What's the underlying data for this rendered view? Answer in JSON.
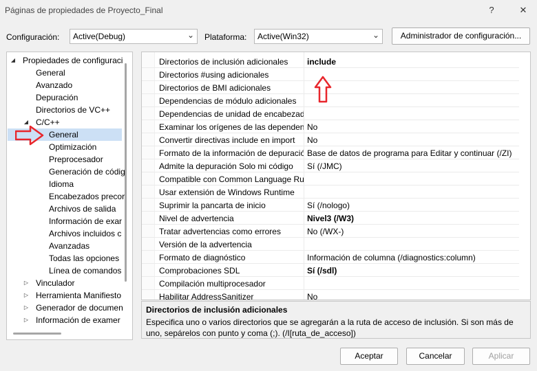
{
  "window": {
    "title": "Páginas de propiedades de Proyecto_Final",
    "help_glyph": "?",
    "close_glyph": "✕"
  },
  "toolbar": {
    "config_label": "Configuración:",
    "config_value": "Active(Debug)",
    "platform_label": "Plataforma:",
    "platform_value": "Active(Win32)",
    "config_manager_label": "Administrador de configuración..."
  },
  "tree": {
    "items": [
      {
        "label": "Propiedades de configuraci",
        "indent": 0,
        "expander": "open"
      },
      {
        "label": "General",
        "indent": 1,
        "expander": "none"
      },
      {
        "label": "Avanzado",
        "indent": 1,
        "expander": "none"
      },
      {
        "label": "Depuración",
        "indent": 1,
        "expander": "none"
      },
      {
        "label": "Directorios de VC++",
        "indent": 1,
        "expander": "none"
      },
      {
        "label": "C/C++",
        "indent": 1,
        "expander": "open"
      },
      {
        "label": "General",
        "indent": 2,
        "expander": "none",
        "selected": true
      },
      {
        "label": "Optimización",
        "indent": 2,
        "expander": "none"
      },
      {
        "label": "Preprocesador",
        "indent": 2,
        "expander": "none"
      },
      {
        "label": "Generación de códig",
        "indent": 2,
        "expander": "none"
      },
      {
        "label": "Idioma",
        "indent": 2,
        "expander": "none"
      },
      {
        "label": "Encabezados precor",
        "indent": 2,
        "expander": "none"
      },
      {
        "label": "Archivos de salida",
        "indent": 2,
        "expander": "none"
      },
      {
        "label": "Información de exar",
        "indent": 2,
        "expander": "none"
      },
      {
        "label": "Archivos incluidos c",
        "indent": 2,
        "expander": "none"
      },
      {
        "label": "Avanzadas",
        "indent": 2,
        "expander": "none"
      },
      {
        "label": "Todas las opciones",
        "indent": 2,
        "expander": "none"
      },
      {
        "label": "Línea de comandos",
        "indent": 2,
        "expander": "none"
      },
      {
        "label": "Vinculador",
        "indent": 1,
        "expander": "closed"
      },
      {
        "label": "Herramienta Manifiesto",
        "indent": 1,
        "expander": "closed"
      },
      {
        "label": "Generador de documen",
        "indent": 1,
        "expander": "closed"
      },
      {
        "label": "Información de examer",
        "indent": 1,
        "expander": "closed"
      }
    ]
  },
  "grid": {
    "rows": [
      {
        "name": "Directorios de inclusión adicionales",
        "value": "include",
        "bold": true
      },
      {
        "name": "Directorios #using adicionales",
        "value": "",
        "bold": false
      },
      {
        "name": "Directorios de BMI adicionales",
        "value": "",
        "bold": false
      },
      {
        "name": "Dependencias de módulo adicionales",
        "value": "",
        "bold": false
      },
      {
        "name": "Dependencias de unidad de encabezado",
        "value": "",
        "bold": false
      },
      {
        "name": "Examinar los orígenes de las dependencias",
        "value": "No",
        "bold": false
      },
      {
        "name": "Convertir directivas include en import",
        "value": "No",
        "bold": false
      },
      {
        "name": "Formato de la información de depuración",
        "value": "Base de datos de programa para Editar y continuar (/ZI)",
        "bold": false
      },
      {
        "name": "Admite la depuración Solo mi código",
        "value": "Sí (/JMC)",
        "bold": false
      },
      {
        "name": "Compatible con Common Language Runtime",
        "value": "",
        "bold": false
      },
      {
        "name": "Usar extensión de Windows Runtime",
        "value": "",
        "bold": false
      },
      {
        "name": "Suprimir la pancarta de inicio",
        "value": "Sí (/nologo)",
        "bold": false
      },
      {
        "name": "Nivel de advertencia",
        "value": "Nivel3 (/W3)",
        "bold": true
      },
      {
        "name": "Tratar advertencias como errores",
        "value": "No (/WX-)",
        "bold": false
      },
      {
        "name": "Versión de la advertencia",
        "value": "",
        "bold": false
      },
      {
        "name": "Formato de diagnóstico",
        "value": "Información de columna (/diagnostics:column)",
        "bold": false
      },
      {
        "name": "Comprobaciones SDL",
        "value": "Sí (/sdl)",
        "bold": true
      },
      {
        "name": "Compilación multiprocesador",
        "value": "",
        "bold": false
      },
      {
        "name": "Habilitar AddressSanitizer",
        "value": "No",
        "bold": false
      }
    ]
  },
  "description": {
    "title": "Directorios de inclusión adicionales",
    "text": "Especifica uno o varios directorios que se agregarán a la ruta de acceso de inclusión. Si son más de uno, sepárelos con punto y coma (;). (/I[ruta_de_acceso])"
  },
  "buttons": {
    "accept": "Aceptar",
    "cancel": "Cancelar",
    "apply": "Aplicar"
  },
  "annotation_color": "#e8262c"
}
